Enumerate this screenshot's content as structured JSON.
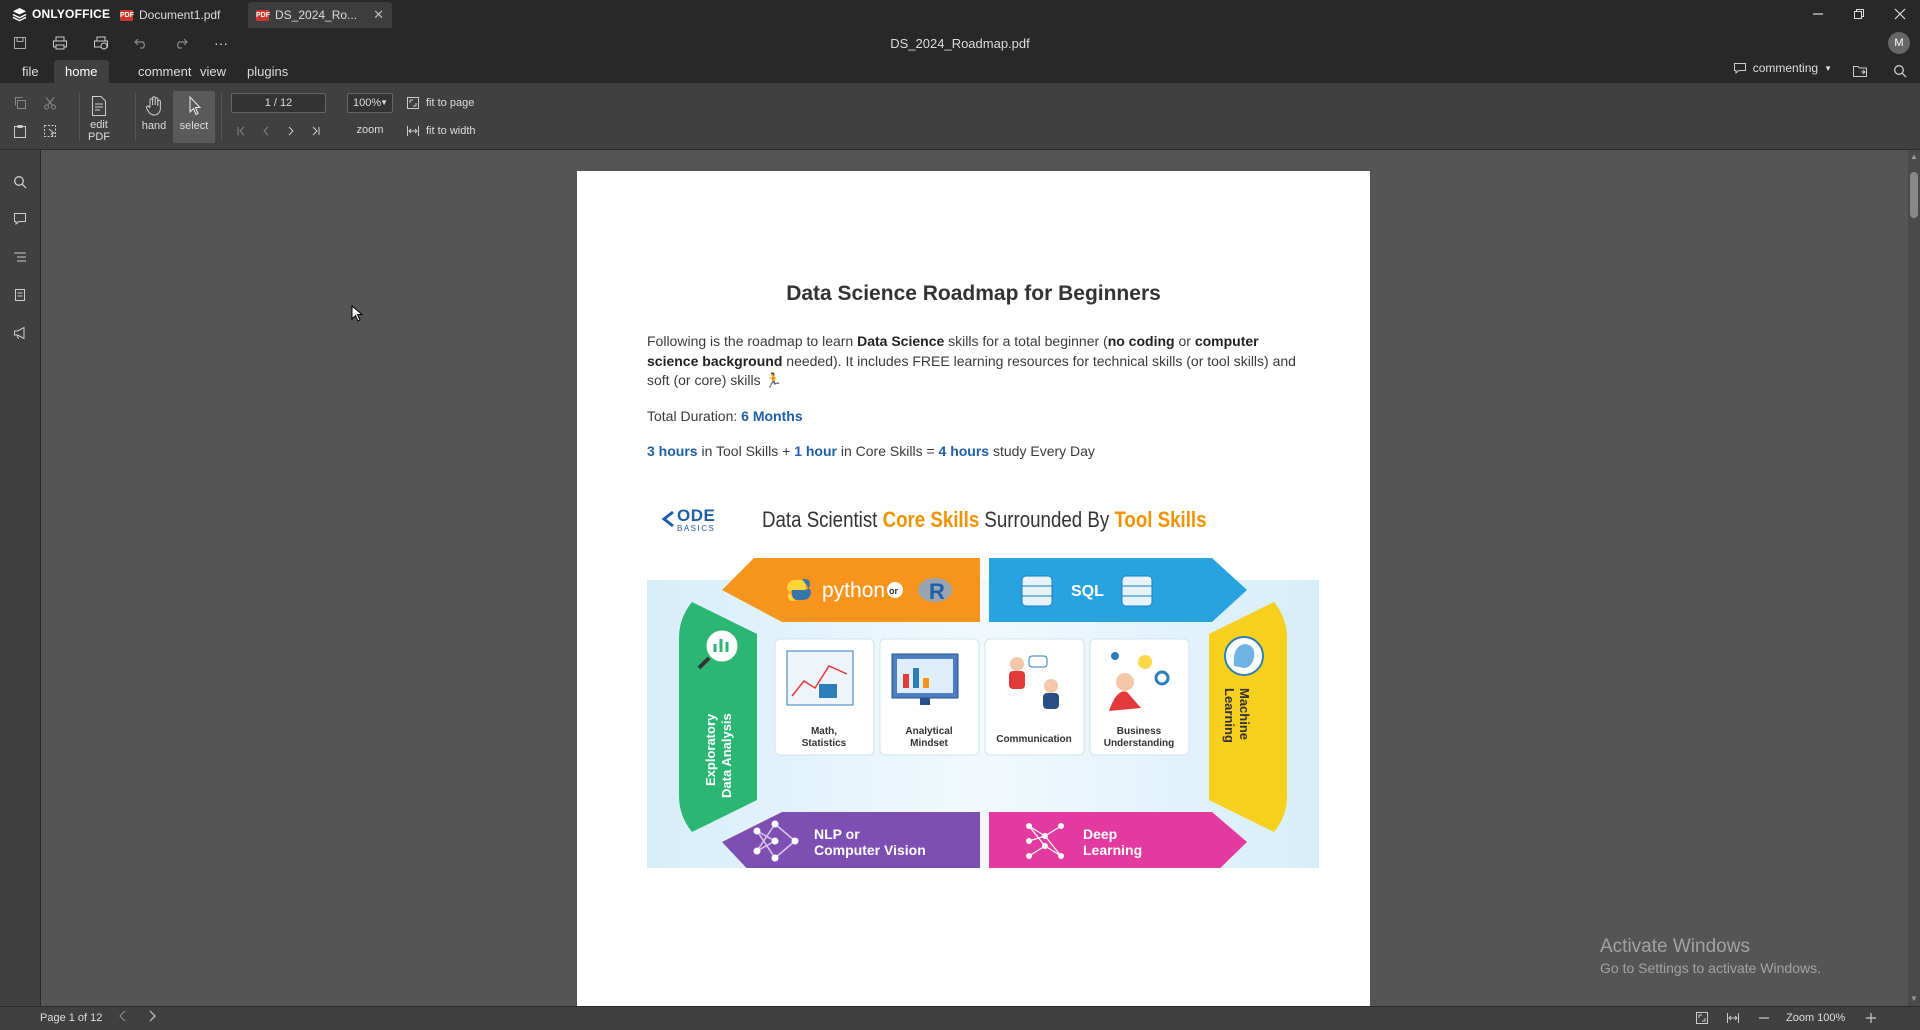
{
  "app": {
    "brand": "ONLYOFFICE",
    "document_title": "DS_2024_Roadmap.pdf",
    "avatar_initial": "M"
  },
  "tabs": [
    {
      "label": "Document1.pdf",
      "badge": "PDF"
    },
    {
      "label": "DS_2024_Ro...",
      "badge": "PDF"
    }
  ],
  "menu": {
    "file": "file",
    "home": "home",
    "comment": "comment",
    "view": "view",
    "plugins": "plugins"
  },
  "mode": {
    "label": "commenting"
  },
  "ribbon": {
    "edit_pdf": "edit PDF",
    "hand": "hand",
    "select": "select",
    "page_field": "1 / 12",
    "zoom_value": "100%",
    "zoom_label": "zoom",
    "fit_to_page": "fit to page",
    "fit_to_width": "fit to width"
  },
  "document": {
    "heading": "Data Science Roadmap for Beginners",
    "intro": {
      "t1": "Following is the roadmap to learn ",
      "b1": "Data Science",
      "t2": " skills for a total beginner (",
      "b2": "no coding",
      "t3": " or ",
      "b3": "computer science background",
      "t4": " needed). It includes FREE learning resources for technical skills (or tool skills) and soft (or core) skills 🏃"
    },
    "duration_label": "Total Duration: ",
    "duration_value": "6 Months",
    "hours": {
      "a": "3 hours",
      "b": " in Tool Skills + ",
      "c": "1 hour",
      "d": " in Core Skills = ",
      "e": "4 hours",
      "f": " study Every Day"
    },
    "infographic": {
      "logo": "ODE",
      "logo_sub": "BASICS",
      "title_a": "Data Scientist ",
      "title_b": "Core Skills",
      "title_c": " Surrounded By ",
      "title_d": "Tool Skills",
      "python": "python",
      "or_small": "or",
      "r_letter": "R",
      "sql": "SQL",
      "eda_1": "Exploratory",
      "eda_2": "Data Analysis",
      "ml_1": "Machine",
      "ml_2": "Learning",
      "nlp_1": "NLP or",
      "nlp_2": "Computer Vision",
      "dl_1": "Deep",
      "dl_2": "Learning",
      "cards": [
        {
          "l1": "Math,",
          "l2": "Statistics"
        },
        {
          "l1": "Analytical",
          "l2": "Mindset"
        },
        {
          "l1": "",
          "l2": "Communication"
        },
        {
          "l1": "Business",
          "l2": "Understanding"
        }
      ],
      "colors": {
        "orange": "#f7941d",
        "blue": "#29a3e0",
        "green": "#2bb673",
        "yellow": "#f7cf1d",
        "purple": "#7d4fb3",
        "pink": "#e23a9e"
      }
    }
  },
  "status": {
    "page_label": "Page 1 of 12",
    "zoom_label": "Zoom 100%"
  },
  "watermark": {
    "line1": "Activate Windows",
    "line2": "Go to Settings to activate Windows."
  }
}
